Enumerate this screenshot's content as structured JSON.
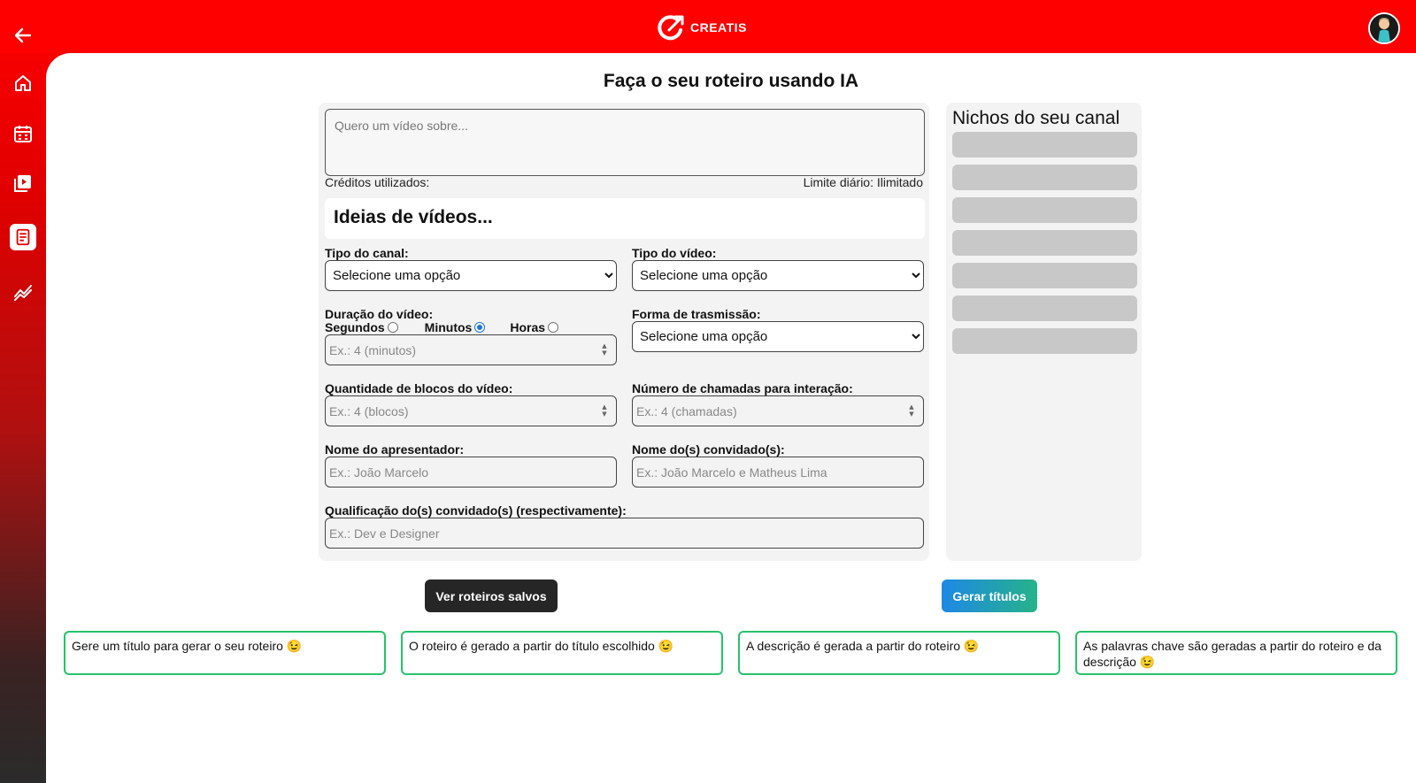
{
  "app": {
    "logo_text": "CREATIS",
    "accent_color": "#ff0000"
  },
  "sidebar": {
    "items": [
      {
        "name": "home",
        "icon": "home-icon"
      },
      {
        "name": "calendar",
        "icon": "calendar-icon"
      },
      {
        "name": "videos",
        "icon": "video-library-icon"
      },
      {
        "name": "scripts",
        "icon": "document-icon",
        "active": true
      },
      {
        "name": "analytics",
        "icon": "trend-chart-icon"
      }
    ]
  },
  "main": {
    "title": "Faça o seu roteiro usando IA"
  },
  "form": {
    "topic_placeholder": "Quero um vídeo sobre...",
    "credits_label": "Créditos utilizados:",
    "limit_label": "Limite diário: Ilimitado",
    "ideas_heading": "Ideias de vídeos...",
    "channel_type": {
      "label": "Tipo do canal:",
      "selected": "Selecione uma opção"
    },
    "video_type": {
      "label": "Tipo do vídeo:",
      "selected": "Selecione uma opção"
    },
    "duration": {
      "label": "Duração do vídeo:",
      "options": [
        {
          "label": "Segundos",
          "checked": false
        },
        {
          "label": "Minutos",
          "checked": true
        },
        {
          "label": "Horas",
          "checked": false
        }
      ],
      "placeholder": "Ex.: 4 (minutos)"
    },
    "transmission": {
      "label": "Forma de trasmissão:",
      "selected": "Selecione uma opção"
    },
    "blocks": {
      "label": "Quantidade de blocos do vídeo:",
      "placeholder": "Ex.: 4 (blocos)"
    },
    "calls": {
      "label": "Número de chamadas para interação:",
      "placeholder": "Ex.: 4 (chamadas)"
    },
    "presenter": {
      "label": "Nome do apresentador:",
      "placeholder": "Ex.: João Marcelo"
    },
    "guests": {
      "label": "Nome do(s) convidado(s):",
      "placeholder": "Ex.: João Marcelo e Matheus Lima"
    },
    "qualification": {
      "label": "Qualificação do(s) convidado(s) (respectivamente):",
      "placeholder": "Ex.: Dev e Designer"
    }
  },
  "niches": {
    "title": "Nichos do seu canal",
    "placeholder_count": 7
  },
  "buttons": {
    "saved_label": "Ver roteiros salvos",
    "generate_label": "Gerar títulos"
  },
  "steps": [
    "Gere um título para gerar o seu roteiro 😉",
    "O roteiro é gerado a partir do título escolhido 😉",
    "A descrição é gerada a partir do roteiro 😉",
    "As palavras chave são geradas a partir do roteiro e da descrição 😉"
  ]
}
